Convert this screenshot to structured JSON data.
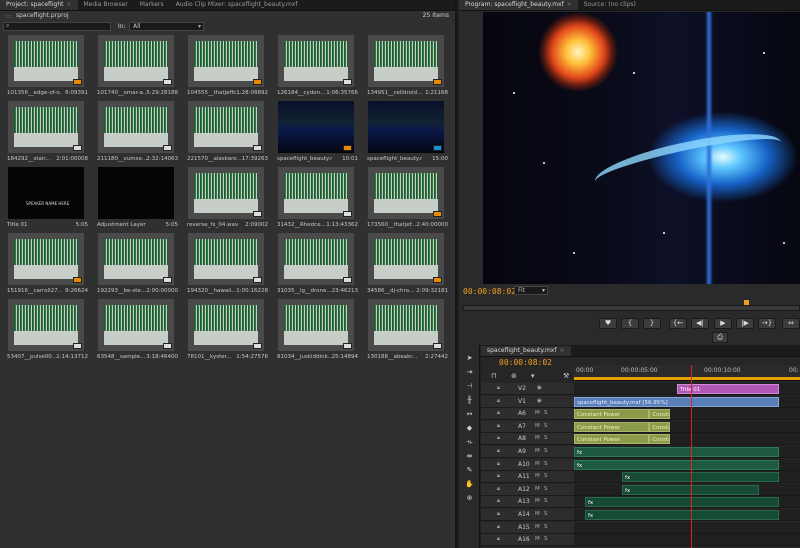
{
  "project": {
    "tabs": [
      {
        "label": "Project: spaceflight"
      },
      {
        "label": "Media Browser"
      },
      {
        "label": "Markers"
      },
      {
        "label": "Audio Clip Mixer: spaceflight_beauty.mxf"
      }
    ],
    "project_file": "spaceflight.prproj",
    "item_count": "25 Items",
    "search_placeholder": "",
    "in_label": "In:",
    "in_value": "All",
    "items": [
      {
        "name": "101356__edge-of-o...",
        "duration": "6:09391",
        "type": "audio",
        "badge": "orange"
      },
      {
        "name": "101740__omar-a...",
        "duration": "5:29:28188",
        "type": "audio",
        "badge": "gray"
      },
      {
        "name": "104555__thatjeffc...",
        "duration": "1:28:08892",
        "type": "audio",
        "badge": "orange"
      },
      {
        "name": "126184__cydon...",
        "duration": "1:06:35766",
        "type": "audio",
        "badge": "gray"
      },
      {
        "name": "134951__celldroid...",
        "duration": "1:21168",
        "type": "audio",
        "badge": "orange"
      },
      {
        "name": "184292__stair...",
        "duration": "2:01:00008",
        "type": "audio",
        "badge": "gray"
      },
      {
        "name": "211180__vumse...",
        "duration": "2:32:14063",
        "type": "audio",
        "badge": "gray"
      },
      {
        "name": "221570__alaskaro...",
        "duration": "17:39263",
        "type": "audio",
        "badge": "gray"
      },
      {
        "name": "spaceflight_beauty.mxf",
        "duration": "10:01",
        "type": "space",
        "badge": "orange"
      },
      {
        "name": "spaceflight_beauty.mxf",
        "duration": "15:00",
        "type": "space",
        "badge": "blue"
      },
      {
        "name": "Title 01",
        "duration": "5:05",
        "type": "black",
        "badge": ""
      },
      {
        "name": "Adjustment Layer",
        "duration": "5:05",
        "type": "black",
        "badge": ""
      },
      {
        "name": "reverse_fx_04.wav",
        "duration": "2:09002",
        "type": "audio",
        "badge": "gray"
      },
      {
        "name": "31432__Rhedce...",
        "duration": "1:13:43362",
        "type": "audio",
        "badge": "gray"
      },
      {
        "name": "173560__thatjef...",
        "duration": "2:40:00000",
        "type": "audio",
        "badge": "orange"
      },
      {
        "name": "151916__carroll27...",
        "duration": "8:26624",
        "type": "audio",
        "badge": "orange"
      },
      {
        "name": "192293__be-ste...",
        "duration": "2:00:00000",
        "type": "audio",
        "badge": "gray"
      },
      {
        "name": "194320__hawaii...",
        "duration": "1:00:16228",
        "type": "audio",
        "badge": "gray"
      },
      {
        "name": "31035__lg__drone...",
        "duration": "23:46213",
        "type": "audio",
        "badge": "gray"
      },
      {
        "name": "34586__dj-chro...",
        "duration": "2:09:32181",
        "type": "audio",
        "badge": "orange"
      },
      {
        "name": "53407__pulse00...",
        "duration": "1:14:13712",
        "type": "audio",
        "badge": "gray"
      },
      {
        "name": "63548__sample...",
        "duration": "3:18:46400",
        "type": "audio",
        "badge": "gray"
      },
      {
        "name": "78101__kyster...",
        "duration": "1:54:27576",
        "type": "audio",
        "badge": "gray"
      },
      {
        "name": "81034__juskiddink...",
        "duration": "25:14894",
        "type": "audio",
        "badge": "gray"
      },
      {
        "name": "130188__abeakr...",
        "duration": "2:27442",
        "type": "audio",
        "badge": "gray"
      }
    ],
    "title_card_text": "SPEAKER NAME HERE"
  },
  "program": {
    "tabs": [
      {
        "label": "Program: spaceflight_beauty.mxf"
      },
      {
        "label": "Source: (no clips)"
      }
    ],
    "timecode": "00:00:08:02",
    "fit": "Fit",
    "buttons": [
      "♥",
      "{",
      "}",
      "{←",
      "◀|",
      "▶",
      "|▶",
      "→}",
      "⇔"
    ]
  },
  "timeline": {
    "tab": "spaceflight_beauty.mxf",
    "timecode": "00:00:08:02",
    "ruler": [
      "00:00",
      "00:00:05:00",
      "00:00:10:00",
      "00:"
    ],
    "tracks": [
      {
        "name": "V2",
        "clips": [
          {
            "label": "Title 01",
            "kind": "title",
            "start": 7.5,
            "end": 15
          }
        ]
      },
      {
        "name": "V1",
        "clips": [
          {
            "label": "spaceflight_beauty.mxf [56.95%]",
            "kind": "v1",
            "start": 0,
            "end": 15
          }
        ]
      },
      {
        "name": "A6",
        "clips": [
          {
            "label": "Constant Power",
            "kind": "aud",
            "start": 0,
            "end": 5.5
          },
          {
            "label": "Constant Power",
            "kind": "aud",
            "start": 5.5,
            "end": 7
          }
        ]
      },
      {
        "name": "A7",
        "clips": [
          {
            "label": "Constant Power",
            "kind": "aud",
            "start": 0,
            "end": 5.5
          },
          {
            "label": "Constant Power",
            "kind": "aud",
            "start": 5.5,
            "end": 7
          }
        ]
      },
      {
        "name": "A8",
        "clips": [
          {
            "label": "Constant Power",
            "kind": "aud",
            "start": 0,
            "end": 5.5
          },
          {
            "label": "Constant Power",
            "kind": "aud",
            "start": 5.5,
            "end": 7
          }
        ]
      },
      {
        "name": "A9",
        "clips": [
          {
            "label": "fx",
            "kind": "gr",
            "start": 0,
            "end": 15
          }
        ]
      },
      {
        "name": "A10",
        "clips": [
          {
            "label": "fx",
            "kind": "gr",
            "start": 0,
            "end": 15
          }
        ]
      },
      {
        "name": "A11",
        "clips": [
          {
            "label": "fx",
            "kind": "dk",
            "start": 3.5,
            "end": 15
          }
        ]
      },
      {
        "name": "A12",
        "clips": [
          {
            "label": "fx",
            "kind": "dk",
            "start": 3.5,
            "end": 13.5
          }
        ]
      },
      {
        "name": "A13",
        "clips": [
          {
            "label": "fx",
            "kind": "dk",
            "start": 0.8,
            "end": 15
          }
        ]
      },
      {
        "name": "A14",
        "clips": [
          {
            "label": "fx",
            "kind": "dk",
            "start": 0.8,
            "end": 15
          }
        ]
      },
      {
        "name": "A15",
        "clips": []
      },
      {
        "name": "A16",
        "clips": []
      }
    ]
  },
  "colors": {
    "accent": "#e88b00",
    "timecode": "#f0a020",
    "playhead": "#e02020"
  }
}
